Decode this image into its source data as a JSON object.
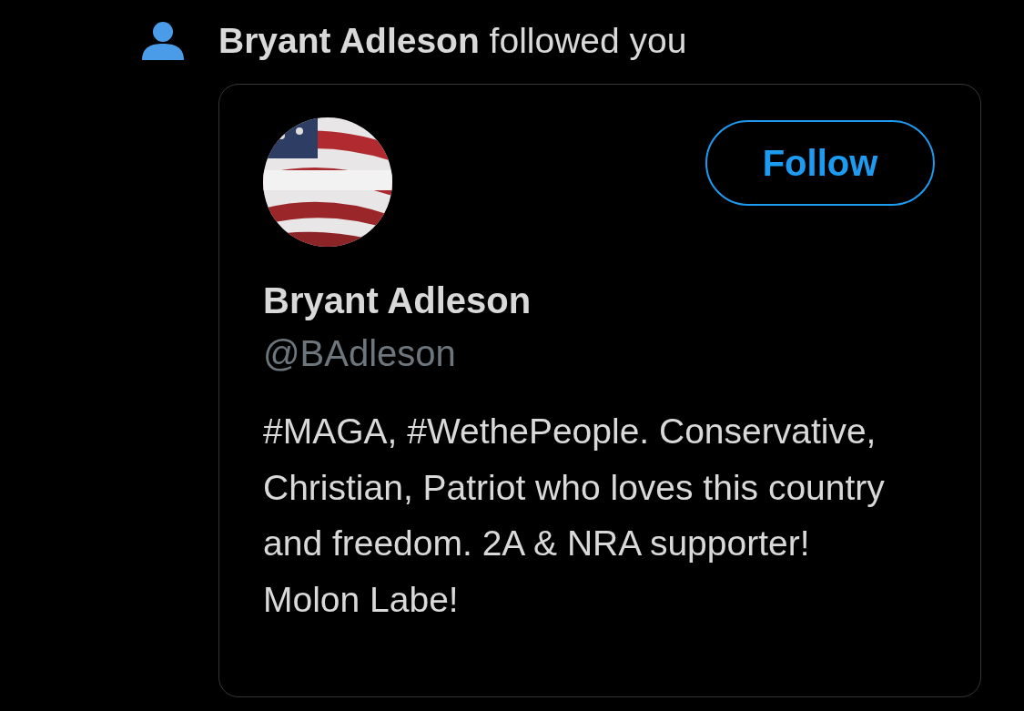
{
  "notification": {
    "kind": "follow",
    "text": "**Bryant Adleson** followed you"
  },
  "card": {
    "follow_button": {
      "label": "Follow",
      "selected": false
    },
    "name": "Bryant Adleson",
    "handle": "@BAdleson",
    "bio": "#MAGA, #WethePeople. Conservative, Christian, Patriot who loves this country and freedom. 2A & NRA supporter! Molon Labe!"
  }
}
